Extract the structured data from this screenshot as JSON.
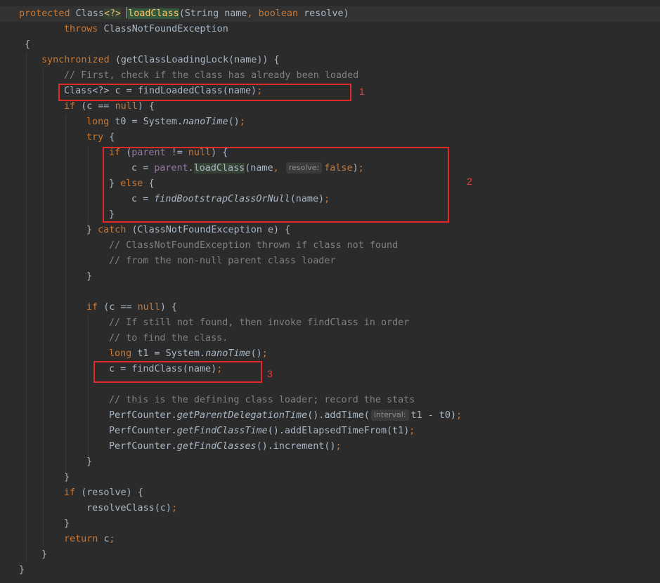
{
  "code": {
    "line1": {
      "kw_protected": "protected",
      "type_class": "Class",
      "generic": "<?>",
      "method": "loadClass",
      "open": "(String name",
      "comma": ",",
      "kw_boolean": "boolean",
      "rest": "resolve)"
    },
    "line2": {
      "kw_throws": "throws",
      "exc": "ClassNotFoundException"
    },
    "line3": {
      "brace": "{"
    },
    "line4": {
      "kw_synchronized": "synchronized",
      "rest": "(getClassLoadingLock(name)) {"
    },
    "line5": {
      "comment": "// First, check if the class has already been loaded"
    },
    "line6": {
      "code": "Class<?> c = findLoadedClass(name)",
      "semi": ";"
    },
    "line7": {
      "kw_if": "if",
      "mid": "(c == ",
      "kw_null": "null",
      "end": ") {"
    },
    "line8": {
      "kw_long": "long",
      "mid": "t0 = System.",
      "call": "nanoTime",
      "end": "()",
      "semi": ";"
    },
    "line9": {
      "kw_try": "try",
      "end": "{"
    },
    "line10": {
      "kw_if": "if",
      "open": "(",
      "field": "parent",
      "mid": " != ",
      "kw_null": "null",
      "end": ") {"
    },
    "line11": {
      "lead": "c = ",
      "field": "parent",
      "dot": ".",
      "call": "loadClass",
      "mid": "(name",
      "comma": ",",
      "hint": "resolve:",
      "kw_false": "false",
      "end": ")",
      "semi": ";"
    },
    "line12": {
      "close": "}",
      "kw_else": "else",
      "end": "{"
    },
    "line13": {
      "lead": "c = ",
      "call": "findBootstrapClassOrNull",
      "mid": "(name)",
      "semi": ";"
    },
    "line14": {
      "brace": "}"
    },
    "line15": {
      "close": "}",
      "kw_catch": "catch",
      "rest": "(ClassNotFoundException e) {"
    },
    "line16": {
      "comment": "// ClassNotFoundException thrown if class not found"
    },
    "line17": {
      "comment": "// from the non-null parent class loader"
    },
    "line18": {
      "brace": "}"
    },
    "line19": {
      "kw_if": "if",
      "mid": "(c == ",
      "kw_null": "null",
      "end": ") {"
    },
    "line20": {
      "comment": "// If still not found, then invoke findClass in order"
    },
    "line21": {
      "comment": "// to find the class."
    },
    "line22": {
      "kw_long": "long",
      "mid": "t1 = System.",
      "call": "nanoTime",
      "end": "()",
      "semi": ";"
    },
    "line23": {
      "code": "c = findClass(name)",
      "semi": ";"
    },
    "line24": {
      "comment": "// this is the defining class loader; record the stats"
    },
    "line25": {
      "lead": "PerfCounter.",
      "call": "getParentDelegationTime",
      "mid": "().addTime(",
      "hint": "interval:",
      "end": "t1 - t0)",
      "semi": ";"
    },
    "line26": {
      "lead": "PerfCounter.",
      "call": "getFindClassTime",
      "mid": "().addElapsedTimeFrom(t1)",
      "semi": ";"
    },
    "line27": {
      "lead": "PerfCounter.",
      "call": "getFindClasses",
      "mid": "().increment()",
      "semi": ";"
    },
    "line28": {
      "brace": "}"
    },
    "line29": {
      "brace": "}"
    },
    "line30": {
      "kw_if": "if",
      "rest": "(resolve) {"
    },
    "line31": {
      "code": "resolveClass(c)",
      "semi": ";"
    },
    "line32": {
      "brace": "}"
    },
    "line33": {
      "kw_return": "return",
      "rest": "c",
      "semi": ";"
    },
    "line34": {
      "brace": "}"
    },
    "line35": {
      "brace": "}"
    }
  },
  "annotations": [
    {
      "label": "1"
    },
    {
      "label": "2"
    },
    {
      "label": "3"
    }
  ],
  "colors": {
    "background": "#2b2b2b",
    "keyword": "#cc7832",
    "method_decl": "#ffc66d",
    "comment": "#808080",
    "field": "#9876aa",
    "text": "#a9b7c6",
    "annotation_box": "#e02a2a"
  }
}
